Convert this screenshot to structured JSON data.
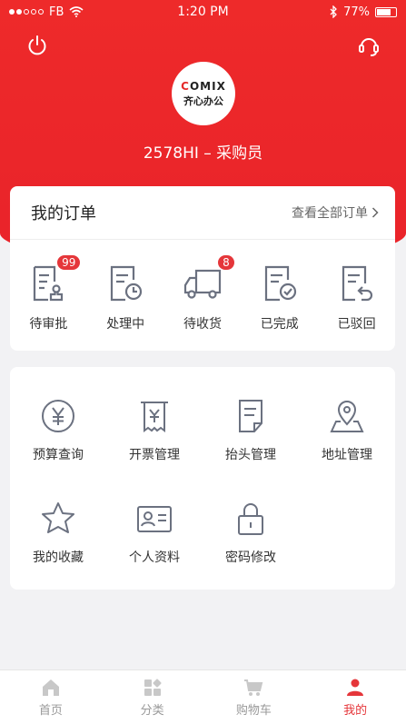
{
  "status_bar": {
    "carrier": "FB",
    "time": "1:20 PM",
    "battery": "77%",
    "battery_level": 0.77
  },
  "profile": {
    "logo_top": "OMIX",
    "logo_initial": "C",
    "logo_bottom": "齐心办公",
    "user_line": "2578HI – 采购员"
  },
  "orders": {
    "title": "我的订单",
    "view_all": "查看全部订单",
    "items": [
      {
        "label": "待审批",
        "badge": "99"
      },
      {
        "label": "处理中",
        "badge": ""
      },
      {
        "label": "待收货",
        "badge": "8"
      },
      {
        "label": "已完成",
        "badge": ""
      },
      {
        "label": "已驳回",
        "badge": ""
      }
    ]
  },
  "tools": {
    "items": [
      {
        "label": "预算查询",
        "icon": "yuan-coin-icon"
      },
      {
        "label": "开票管理",
        "icon": "receipt-icon"
      },
      {
        "label": "抬头管理",
        "icon": "document-icon"
      },
      {
        "label": "地址管理",
        "icon": "location-pin-icon"
      },
      {
        "label": "我的收藏",
        "icon": "star-icon"
      },
      {
        "label": "个人资料",
        "icon": "id-card-icon"
      },
      {
        "label": "密码修改",
        "icon": "lock-icon"
      }
    ]
  },
  "tabbar": {
    "items": [
      {
        "label": "首页",
        "active": false
      },
      {
        "label": "分类",
        "active": false
      },
      {
        "label": "购物车",
        "active": false
      },
      {
        "label": "我的",
        "active": true
      }
    ]
  },
  "colors": {
    "brand_red": "#e9232a",
    "badge_red": "#e5363a",
    "icon_gray": "#6b7180",
    "tab_inactive": "#c8c8c8"
  }
}
